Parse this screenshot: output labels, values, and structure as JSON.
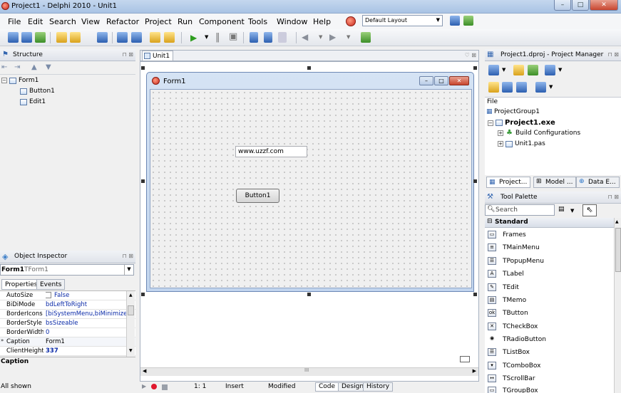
{
  "window": {
    "title": "Project1 - Delphi 2010 - Unit1",
    "minimize": "–",
    "maximize": "□",
    "close": "✕"
  },
  "menu": {
    "items": [
      "File",
      "Edit",
      "Search",
      "View",
      "Refactor",
      "Project",
      "Run",
      "Component",
      "Tools",
      "Window",
      "Help"
    ],
    "layout_combo": "Default Layout"
  },
  "structure": {
    "title": "Structure",
    "tree": [
      "Form1",
      "Button1",
      "Edit1"
    ]
  },
  "designer": {
    "tab_label": "Unit1",
    "form_caption": "Form1",
    "edit_text": "www.uzzf.com",
    "button_caption": "Button1",
    "bottom_tabs": [
      "Code",
      "Design",
      "History"
    ]
  },
  "object_inspector": {
    "title": "Object Inspector",
    "selected_name": "Form1",
    "selected_type": "TForm1",
    "tabs": [
      "Properties",
      "Events"
    ],
    "properties": [
      {
        "k": "AutoSize",
        "v": "False"
      },
      {
        "k": "BiDiMode",
        "v": "bdLeftToRight"
      },
      {
        "k": "BorderIcons",
        "v": "[biSystemMenu,biMinimize,b"
      },
      {
        "k": "BorderStyle",
        "v": "bsSizeable"
      },
      {
        "k": "BorderWidth",
        "v": "0"
      },
      {
        "k": "Caption",
        "v": "Form1"
      },
      {
        "k": "ClientHeight",
        "v": "337"
      }
    ],
    "description_title": "Caption",
    "status": "All shown"
  },
  "project_manager": {
    "title": "Project1.dproj - Project Manager",
    "file_header": "File",
    "tree": [
      "ProjectGroup1",
      "Project1.exe",
      "Build Configurations",
      "Unit1.pas"
    ],
    "tabs": [
      "Project...",
      "Model ...",
      "Data E..."
    ]
  },
  "tool_palette": {
    "title": "Tool Palette",
    "search_placeholder": "Search",
    "category": "Standard",
    "items": [
      "Frames",
      "TMainMenu",
      "TPopupMenu",
      "TLabel",
      "TEdit",
      "TMemo",
      "TButton",
      "TCheckBox",
      "TRadioButton",
      "TListBox",
      "TComboBox",
      "TScrollBar",
      "TGroupBox"
    ]
  },
  "statusbar": {
    "position": "1: 1",
    "mode": "Insert",
    "state": "Modified"
  }
}
